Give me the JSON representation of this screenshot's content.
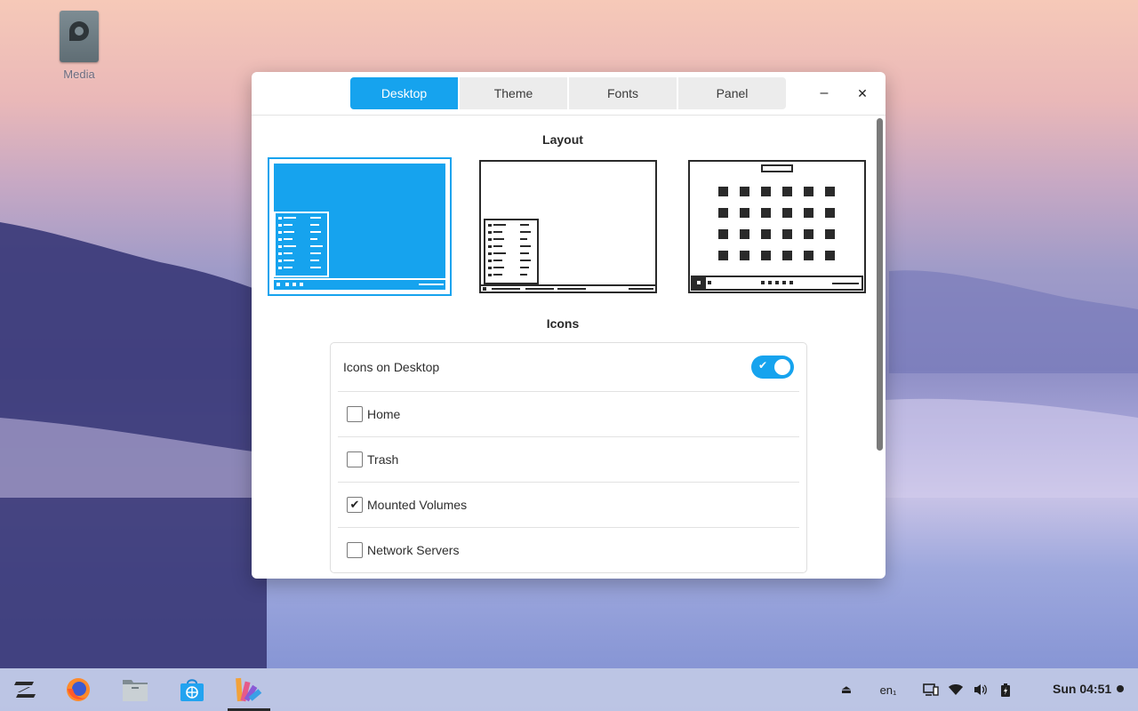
{
  "desktop": {
    "icon_label": "Media"
  },
  "window": {
    "tabs": [
      "Desktop",
      "Theme",
      "Fonts",
      "Panel"
    ],
    "active_tab": "Desktop",
    "minimize_glyph": "–",
    "close_glyph": "✕",
    "layout": {
      "title": "Layout",
      "options": [
        "classic-menu-layout",
        "compact-menu-layout",
        "launcher-grid-layout"
      ],
      "selected": "classic-menu-layout"
    },
    "icons": {
      "title": "Icons",
      "toggle_label": "Icons on Desktop",
      "toggle_on": true,
      "items": [
        {
          "label": "Home",
          "checked": false
        },
        {
          "label": "Trash",
          "checked": false
        },
        {
          "label": "Mounted Volumes",
          "checked": true
        },
        {
          "label": "Network Servers",
          "checked": false
        }
      ]
    }
  },
  "taskbar": {
    "apps": [
      "zorin-menu-icon",
      "firefox-icon",
      "files-icon",
      "software-store-icon",
      "appearance-icon"
    ],
    "active_app": "appearance-icon",
    "tray": {
      "keyboard_layout": "en₁",
      "clock": "Sun 04:51"
    }
  },
  "colors": {
    "accent": "#16a3ee",
    "taskbar": "#c4cce6"
  }
}
